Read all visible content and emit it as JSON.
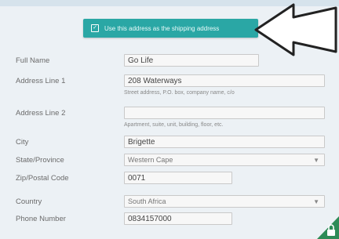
{
  "header": {
    "title": ""
  },
  "shipping_toggle": {
    "label": "Use this address as the shipping address",
    "checked": true,
    "check_glyph": "✓"
  },
  "form": {
    "full_name": {
      "label": "Full Name",
      "value": "Go Life"
    },
    "address1": {
      "label": "Address Line 1",
      "value": "208 Waterways",
      "hint": "Street address, P.O. box, company name, c/o"
    },
    "address2": {
      "label": "Address Line 2",
      "value": "",
      "hint": "Apartment, suite, unit, building, floor, etc."
    },
    "city": {
      "label": "City",
      "value": "Brigette"
    },
    "state": {
      "label": "State/Province",
      "value": "Western Cape"
    },
    "zip": {
      "label": "Zip/Postal Code",
      "value": "0071"
    },
    "country": {
      "label": "Country",
      "value": "South Africa"
    },
    "phone": {
      "label": "Phone Number",
      "value": "0834157000"
    }
  },
  "colors": {
    "accent": "#2aa7a5",
    "corner": "#2e8b57"
  },
  "icons": {
    "pointer": "arrow-icon",
    "corner": "lock-icon"
  }
}
